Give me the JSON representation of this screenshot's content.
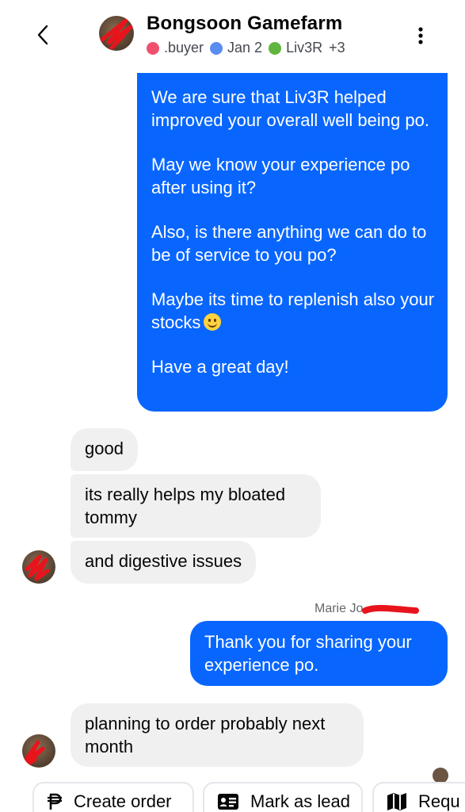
{
  "header": {
    "title": "Bongsoon Gamefarm",
    "labels": [
      {
        "text": ".buyer",
        "color": "#f0506e"
      },
      {
        "text": "Jan 2",
        "color": "#5a8df0"
      },
      {
        "text": "Liv3R",
        "color": "#5fb53d"
      }
    ],
    "extra_labels": "+3",
    "back_icon": "chevron-left-icon",
    "menu_icon": "more-vertical-icon"
  },
  "messages": {
    "outgoing_1": {
      "p1": "We are sure that Liv3R helped improved your overall well being po.",
      "p2": "May we know your experience po after using it?",
      "p3": "Also, is there anything we can do to be of service to you po?",
      "p4": "Maybe its time to replenish also your stocks",
      "p5": "Have a great day!"
    },
    "incoming_1": "good",
    "incoming_2": "its really helps my bloated tommy",
    "incoming_3": "and digestive issues",
    "sender_name": "Marie Jo",
    "outgoing_2": "Thank you for sharing your experience po.",
    "incoming_4": "planning to order probably next month"
  },
  "actions": {
    "create_order": "Create order",
    "mark_as_lead": "Mark as lead",
    "request": "Requ"
  },
  "colors": {
    "outgoing_bubble": "#0866ff",
    "incoming_bubble": "#f0f0f0"
  }
}
